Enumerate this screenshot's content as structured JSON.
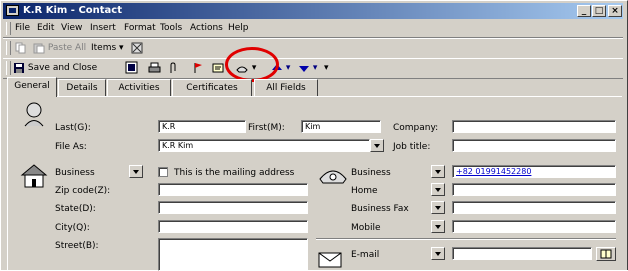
{
  "window": {
    "title": "K.R Kim - Contact",
    "min": "_",
    "max": "□",
    "close": "×"
  },
  "menu": [
    "File",
    "Edit",
    "View",
    "Insert",
    "Format",
    "Tools",
    "Actions",
    "Help"
  ],
  "toolbar1": {
    "paste_all": "Paste All",
    "items": "Items"
  },
  "toolbar2": {
    "save_close": "Save and Close"
  },
  "tabs": [
    "General",
    "Details",
    "Activities",
    "Certificates",
    "All Fields"
  ],
  "form": {
    "last_label": "Last(G):",
    "last_value": "K.R",
    "first_label": "First(M):",
    "first_value": "Kim",
    "company_label": "Company:",
    "company_value": "",
    "fileas_label": "File As:",
    "fileas_value": "K.R Kim",
    "jobtitle_label": "Job title:",
    "jobtitle_value": "",
    "address_type": "Business",
    "mailing_label": "This is the mailing address",
    "zip_label": "Zip code(Z):",
    "zip_value": "",
    "state_label": "State(D):",
    "state_value": "",
    "city_label": "City(Q):",
    "city_value": "",
    "street_label": "Street(B):",
    "street_value": "",
    "phones": [
      {
        "label": "Business",
        "value": "+82 01991452280"
      },
      {
        "label": "Home",
        "value": ""
      },
      {
        "label": "Business Fax",
        "value": ""
      },
      {
        "label": "Mobile",
        "value": ""
      }
    ],
    "email_label": "E-mail",
    "email_value": ""
  }
}
